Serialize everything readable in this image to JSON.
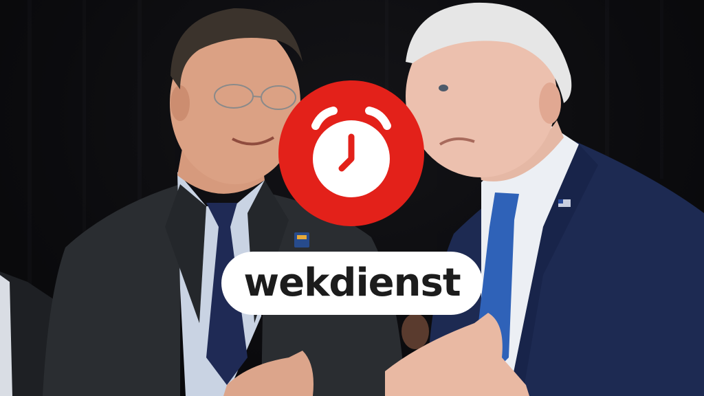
{
  "label": {
    "text": "wekdienst"
  },
  "badge": {
    "icon": "alarm-clock-icon",
    "background_color": "#e3211a",
    "icon_color": "#ffffff"
  },
  "colors": {
    "pill_background": "#ffffff",
    "label_text": "#1c1c1c",
    "backdrop": "#0b0b0d"
  }
}
